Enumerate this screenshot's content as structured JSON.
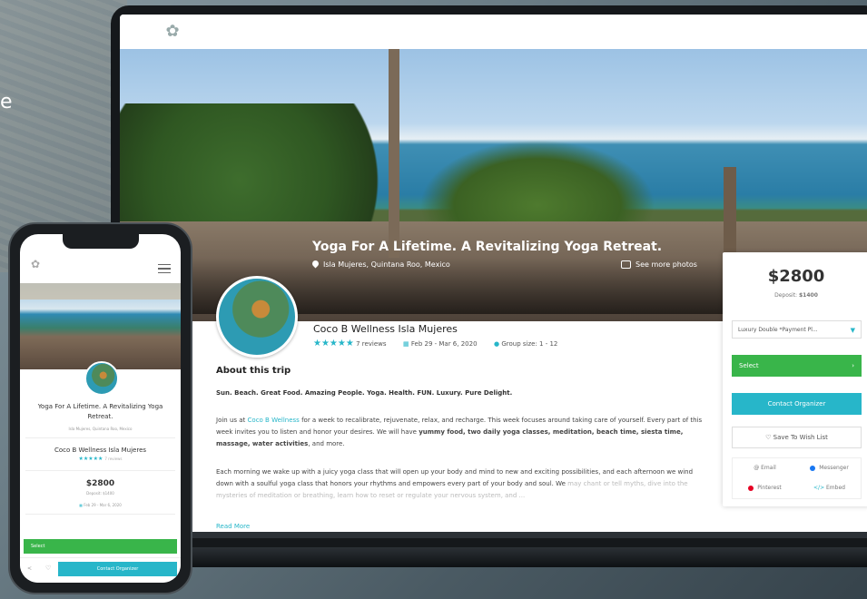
{
  "background": {
    "partial_letter": "e"
  },
  "site": {
    "logo_icon": "lotus-icon"
  },
  "hero": {
    "title": "Yoga For A Lifetime. A Revitalizing Yoga Retreat.",
    "location": "Isla Mujeres, Quintana Roo, Mexico",
    "photos_label": "See more photos"
  },
  "organizer": {
    "name": "Coco B Wellness Isla Mujeres",
    "stars": "★★★★★",
    "reviews": "7 reviews",
    "dates": "Feb 29 - Mar 6, 2020",
    "group": "Group size: 1 - 12"
  },
  "about": {
    "heading": "About this trip",
    "tagline": "Sun. Beach. Great Food. Amazing People. Yoga. Health. FUN. Luxury. Pure Delight.",
    "p2_pre": "Join us at ",
    "p2_link": "Coco B Wellness",
    "p2_mid": " for a week to recalibrate, rejuvenate, relax, and recharge. This week focuses around taking care of yourself. Every part of this week invites you to listen and honor your desires. We will have ",
    "p2_bold": "yummy food, two daily yoga classes, meditation, beach time, siesta time, massage, water activities",
    "p2_end": ", and more.",
    "p3": "Each morning we wake up with a juicy yoga class that will open up your body and mind to new and exciting possibilities, and each afternoon we wind down with a soulful yoga class that honors your rhythms and empowers every part of your body and soul. We",
    "p3_fade": "may chant or tell myths, dive into the mysteries of meditation or breathing, learn how to reset or regulate your nervous system, and ...",
    "read_more": "Read More"
  },
  "booking": {
    "price": "$2800",
    "deposit_label": "Deposit:",
    "deposit_value": "$1400",
    "room_option": "Luxury Double *Payment Pl...",
    "select_label": "Select",
    "contact_label": "Contact Organizer",
    "wishlist_label": "Save To Wish List",
    "share": {
      "email": "Email",
      "messenger": "Messenger",
      "pinterest": "Pinterest",
      "embed": "Embed"
    },
    "colors": {
      "green": "#39b54a",
      "teal": "#27b6c9"
    }
  },
  "phone": {
    "title": "Yoga For A Lifetime. A Revitalizing Yoga Retreat.",
    "location": "Isla Mujeres, Quintana Roo, Mexico",
    "org_name": "Coco B Wellness Isla Mujeres",
    "stars": "★★★★★",
    "reviews": "7 reviews",
    "price": "$2800",
    "deposit": "Deposit: $1400",
    "dates": "Feb 29 - Mar 6, 2020",
    "select_label": "Select",
    "contact_label": "Contact Organizer"
  }
}
